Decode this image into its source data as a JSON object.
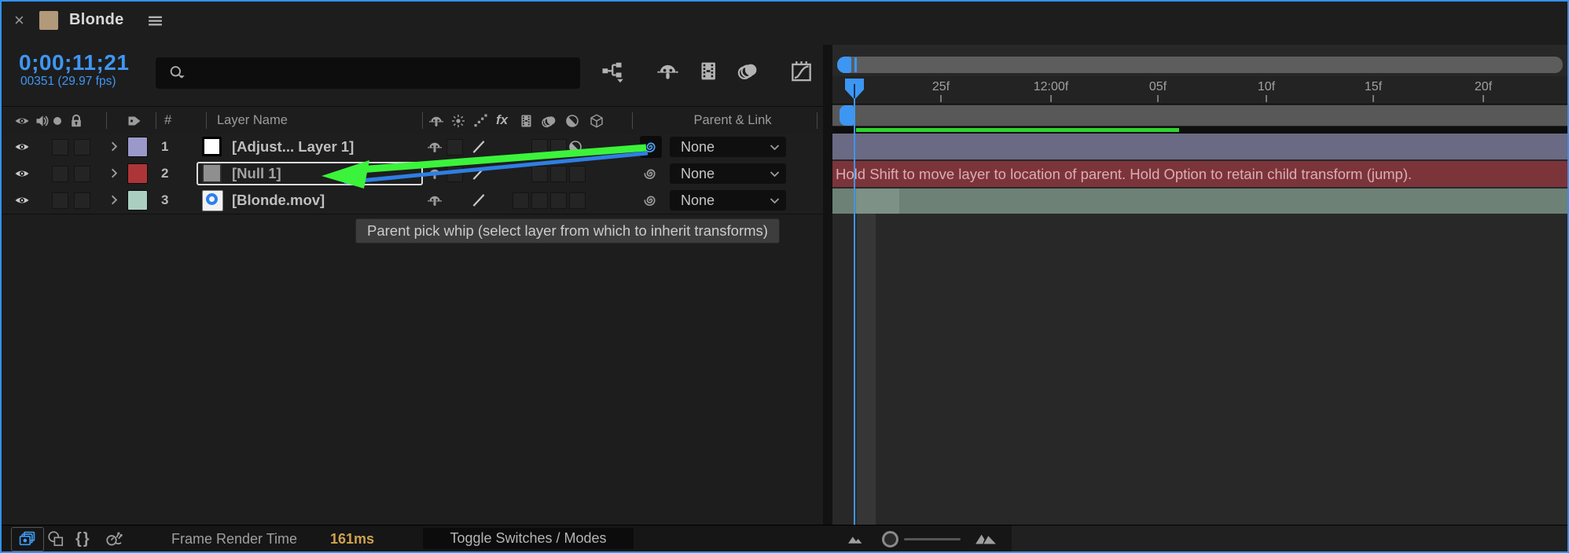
{
  "tab": {
    "close_label": "×",
    "title": "Blonde"
  },
  "time": {
    "timecode": "0;00;11;21",
    "frame_info": "00351 (29.97 fps)"
  },
  "search": {
    "value": ""
  },
  "columns": {
    "hash": "#",
    "layer_name": "Layer Name",
    "parent_link": "Parent & Link"
  },
  "icons": {
    "fx_label": "fx",
    "braces_label": "{}"
  },
  "layers": [
    {
      "number": "1",
      "name": "[Adjust... Layer 1]",
      "label_color": "#9b99c9",
      "parent": "None"
    },
    {
      "number": "2",
      "name": "[Null 1]",
      "label_color": "#ad3538",
      "parent": "None"
    },
    {
      "number": "3",
      "name": "[Blonde.mov]",
      "label_color": "#aacfc0",
      "parent": "None"
    }
  ],
  "tooltip": {
    "text": "Parent pick whip (select layer from which to inherit transforms)"
  },
  "status_bar": {
    "message": "Hold Shift to move layer to location of parent. Hold Option to retain child transform (jump)."
  },
  "ruler": {
    "labels": [
      "25f",
      "12:00f",
      "05f",
      "10f",
      "15f",
      "20f"
    ]
  },
  "footer": {
    "frame_render_label": "Frame Render Time",
    "frame_render_value": "161ms",
    "toggle_switches_label": "Toggle Switches / Modes"
  },
  "colors": {
    "focus_border": "#3291f4",
    "timecode_blue": "#3f96f3",
    "tab_swatch_tan": "#b1997a",
    "label_lavender": "#9b99c9",
    "label_red": "#ad3538",
    "label_seafoam": "#aacfc0",
    "bar_lavender": "#6a6a84",
    "bar_red": "#7c343b",
    "bar_seafoam": "#6e8177",
    "progress_green": "#2fd32f",
    "arrow_green": "#3bf33b",
    "pickwhip_blue_line": "#2e7fe3",
    "warning_text": "#dcacb2",
    "render_time_gold": "#d0a24f"
  }
}
